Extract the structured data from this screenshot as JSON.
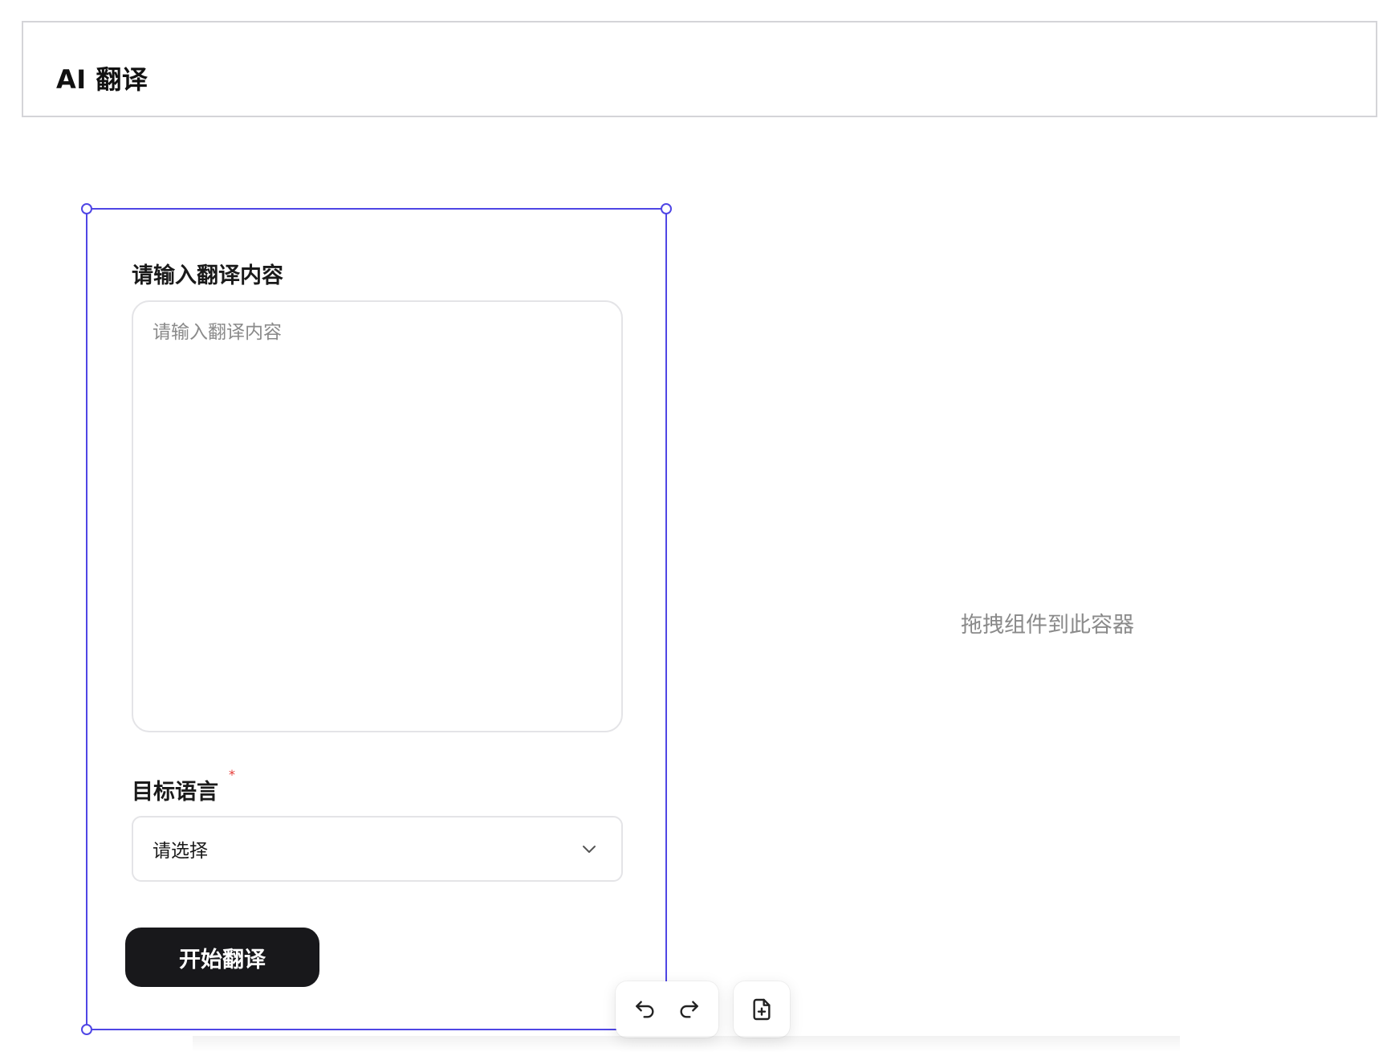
{
  "header": {
    "title": "AI 翻译"
  },
  "form": {
    "content_label": "请输入翻译内容",
    "content_placeholder": "请输入翻译内容",
    "content_value": "",
    "language_label": "目标语言",
    "language_required_mark": "*",
    "language_select_value": "请选择",
    "submit_label": "开始翻译"
  },
  "canvas": {
    "drop_hint": "拖拽组件到此容器"
  },
  "toolbar": {
    "icons": [
      "undo-icon",
      "redo-icon",
      "add-page-icon"
    ]
  },
  "colors": {
    "selection": "#4f46e5",
    "button_bg": "#18181b",
    "required": "#e53935",
    "placeholder": "#8a8a8a"
  }
}
